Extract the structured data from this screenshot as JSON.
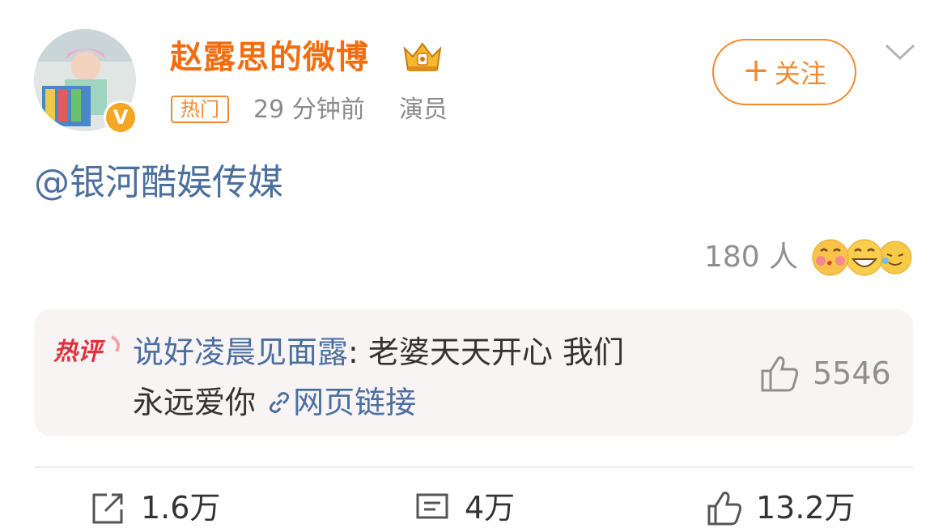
{
  "user": {
    "name": "赵露思的微博",
    "hot_tag": "热门",
    "time": "29 分钟前",
    "role": "演员",
    "follow_label": "关注"
  },
  "post": {
    "mention": "@银河酷娱传媒"
  },
  "reactions": {
    "count": "180 人"
  },
  "hot_comment": {
    "label": "热评",
    "user": "说好凌晨见面露",
    "text_line1": ": 老婆天天开心 我们",
    "text_line2": "永远爱你",
    "link_text": "网页链接",
    "likes": "5546"
  },
  "actions": {
    "share": "1.6万",
    "comment": "4万",
    "like": "13.2万"
  },
  "colors": {
    "accent_orange": "#f08a30",
    "username_orange": "#f26d10",
    "link_blue": "#4b6f9f",
    "hot_box_bg": "#f8f4f4"
  },
  "icons": {
    "verified": "verified-v-badge-icon",
    "crown": "crown-icon",
    "chevron": "chevron-down-icon",
    "link": "link-icon",
    "thumb": "thumbs-up-icon",
    "share": "share-icon",
    "comment": "comment-icon"
  }
}
